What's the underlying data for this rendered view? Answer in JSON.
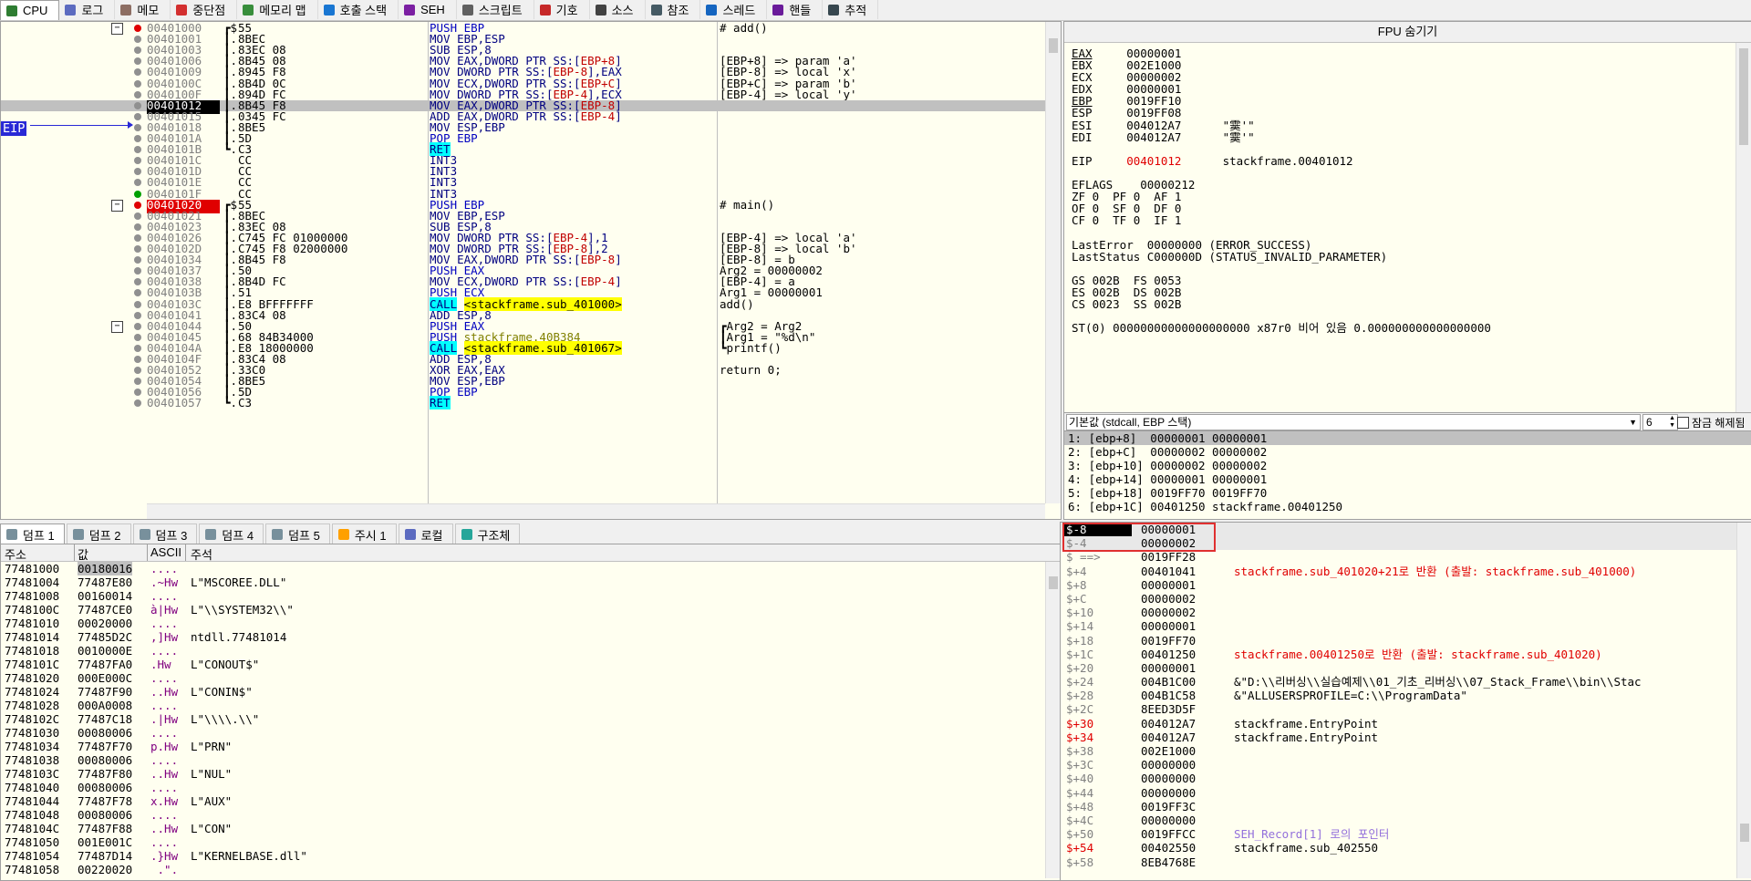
{
  "top_tabs": [
    {
      "label": "CPU",
      "icon": "cpu-icon",
      "active": true
    },
    {
      "label": "로그",
      "icon": "log-icon"
    },
    {
      "label": "메모",
      "icon": "notes-icon"
    },
    {
      "label": "중단점",
      "icon": "breakpoint-icon"
    },
    {
      "label": "메모리 맵",
      "icon": "memory-map-icon"
    },
    {
      "label": "호출 스택",
      "icon": "call-stack-icon"
    },
    {
      "label": "SEH",
      "icon": "seh-icon"
    },
    {
      "label": "스크립트",
      "icon": "script-icon"
    },
    {
      "label": "기호",
      "icon": "symbols-icon"
    },
    {
      "label": "소스",
      "icon": "source-icon"
    },
    {
      "label": "참조",
      "icon": "references-icon"
    },
    {
      "label": "스레드",
      "icon": "threads-icon"
    },
    {
      "label": "핸들",
      "icon": "handles-icon"
    },
    {
      "label": "추적",
      "icon": "trace-icon"
    }
  ],
  "eip_label": "EIP",
  "disasm": [
    {
      "addr": "00401000",
      "brk": true,
      "fold": true,
      "b": "┏$",
      "bytes": "55",
      "asm": "PUSH EBP",
      "cmt": "# add()",
      "kind": "push"
    },
    {
      "addr": "00401001",
      "b": "┃.",
      "bytes": "8BEC",
      "asm": "MOV EBP,ESP",
      "cmt": ""
    },
    {
      "addr": "00401003",
      "b": "┃.",
      "bytes": "83EC 08",
      "asm": "SUB ESP,8",
      "cmt": ""
    },
    {
      "addr": "00401006",
      "b": "┃.",
      "bytes": "8B45 08",
      "asm": "MOV EAX,DWORD PTR SS:[EBP+8]",
      "cmt": "[EBP+8] => param 'a'"
    },
    {
      "addr": "00401009",
      "b": "┃.",
      "bytes": "8945 F8",
      "asm": "MOV DWORD PTR SS:[EBP-8],EAX",
      "cmt": "[EBP-8] => local 'x'"
    },
    {
      "addr": "0040100C",
      "b": "┃.",
      "bytes": "8B4D 0C",
      "asm": "MOV ECX,DWORD PTR SS:[EBP+C]",
      "cmt": "[EBP+C] => param 'b'"
    },
    {
      "addr": "0040100F",
      "b": "┃.",
      "bytes": "894D FC",
      "asm": "MOV DWORD PTR SS:[EBP-4],ECX",
      "cmt": "[EBP-4] => local 'y'"
    },
    {
      "addr": "00401012",
      "eip": true,
      "b": "┃.",
      "bytes": "8B45 F8",
      "asm": "MOV EAX,DWORD PTR SS:[EBP-8]",
      "cmt": ""
    },
    {
      "addr": "00401015",
      "b": "┃.",
      "bytes": "0345 FC",
      "asm": "ADD EAX,DWORD PTR SS:[EBP-4]",
      "cmt": ""
    },
    {
      "addr": "00401018",
      "b": "┃.",
      "bytes": "8BE5",
      "asm": "MOV ESP,EBP",
      "cmt": ""
    },
    {
      "addr": "0040101A",
      "b": "┃.",
      "bytes": "5D",
      "asm": "POP EBP",
      "cmt": "",
      "kind": "push"
    },
    {
      "addr": "0040101B",
      "b": "┗.",
      "bytes": "C3",
      "asm": "RET",
      "cmt": "",
      "kind": "ret"
    },
    {
      "addr": "0040101C",
      "b": "",
      "bytes": "CC",
      "asm": "INT3",
      "cmt": ""
    },
    {
      "addr": "0040101D",
      "b": "",
      "bytes": "CC",
      "asm": "INT3",
      "cmt": ""
    },
    {
      "addr": "0040101E",
      "b": "",
      "bytes": "CC",
      "asm": "INT3",
      "cmt": ""
    },
    {
      "addr": "0040101F",
      "b": "",
      "bytes": "CC",
      "asm": "INT3",
      "cmt": "",
      "green": true
    },
    {
      "addr": "00401020",
      "brk": true,
      "red": true,
      "fold": true,
      "b": "┏$",
      "bytes": "55",
      "asm": "PUSH EBP",
      "cmt": "# main()",
      "kind": "push"
    },
    {
      "addr": "00401021",
      "b": "┃.",
      "bytes": "8BEC",
      "asm": "MOV EBP,ESP",
      "cmt": ""
    },
    {
      "addr": "00401023",
      "b": "┃.",
      "bytes": "83EC 08",
      "asm": "SUB ESP,8",
      "cmt": ""
    },
    {
      "addr": "00401026",
      "b": "┃.",
      "bytes": "C745 FC 01000000",
      "asm": "MOV DWORD PTR SS:[EBP-4],1",
      "cmt": "[EBP-4] => local 'a'"
    },
    {
      "addr": "0040102D",
      "b": "┃.",
      "bytes": "C745 F8 02000000",
      "asm": "MOV DWORD PTR SS:[EBP-8],2",
      "cmt": "[EBP-8] => local 'b'"
    },
    {
      "addr": "00401034",
      "b": "┃.",
      "bytes": "8B45 F8",
      "asm": "MOV EAX,DWORD PTR SS:[EBP-8]",
      "cmt": "[EBP-8] = b"
    },
    {
      "addr": "00401037",
      "b": "┃.",
      "bytes": "50",
      "asm": "PUSH EAX",
      "cmt": "Arg2 = 00000002",
      "kind": "push"
    },
    {
      "addr": "00401038",
      "b": "┃.",
      "bytes": "8B4D FC",
      "asm": "MOV ECX,DWORD PTR SS:[EBP-4]",
      "cmt": "[EBP-4] = a"
    },
    {
      "addr": "0040103B",
      "b": "┃.",
      "bytes": "51",
      "asm": "PUSH ECX",
      "cmt": "Arg1 = 00000001",
      "kind": "push"
    },
    {
      "addr": "0040103C",
      "b": "┃.",
      "bytes": "E8 BFFFFFFF",
      "asm": "CALL <stackframe.sub_401000>",
      "cmt": "add()",
      "kind": "call"
    },
    {
      "addr": "00401041",
      "b": "┃.",
      "bytes": "83C4 08",
      "asm": "ADD ESP,8",
      "cmt": ""
    },
    {
      "addr": "00401044",
      "fold": true,
      "b": "┃.",
      "bytes": "50",
      "asm": "PUSH EAX",
      "cmt": "┏Arg2 = Arg2",
      "kind": "push"
    },
    {
      "addr": "00401045",
      "b": "┃.",
      "bytes": "68 84B34000",
      "asm": "PUSH stackframe.40B384",
      "cmt": "┃Arg1 = \"%d\\n\"",
      "kind": "push"
    },
    {
      "addr": "0040104A",
      "b": "┃.",
      "bytes": "E8 18000000",
      "asm": "CALL <stackframe.sub_401067>",
      "cmt": "┗printf()",
      "kind": "call"
    },
    {
      "addr": "0040104F",
      "b": "┃.",
      "bytes": "83C4 08",
      "asm": "ADD ESP,8",
      "cmt": ""
    },
    {
      "addr": "00401052",
      "b": "┃.",
      "bytes": "33C0",
      "asm": "XOR EAX,EAX",
      "cmt": "return 0;"
    },
    {
      "addr": "00401054",
      "b": "┃.",
      "bytes": "8BE5",
      "asm": "MOV ESP,EBP",
      "cmt": ""
    },
    {
      "addr": "00401056",
      "b": "┃.",
      "bytes": "5D",
      "asm": "POP EBP",
      "cmt": "",
      "kind": "push"
    },
    {
      "addr": "00401057",
      "b": "┗.",
      "bytes": "C3",
      "asm": "RET",
      "cmt": "",
      "kind": "ret"
    }
  ],
  "fpu": {
    "title": "FPU 숨기기",
    "lines": [
      "EAX     00000001",
      "EBX     002E1000",
      "ECX     00000002",
      "EDX     00000001",
      "EBP     0019FF10",
      "ESP     0019FF08",
      "ESI     004012A7      \"霙'\"",
      "EDI     004012A7      \"霙'\"",
      "",
      "EIP     00401012      stackframe.00401012",
      "",
      "EFLAGS    00000212",
      "ZF 0  PF 0  AF 1",
      "OF 0  SF 0  DF 0",
      "CF 0  TF 0  IF 1",
      "",
      "LastError  00000000 (ERROR_SUCCESS)",
      "LastStatus C000000D (STATUS_INVALID_PARAMETER)",
      "",
      "GS 002B  FS 0053",
      "ES 002B  DS 002B",
      "CS 0023  SS 002B",
      "",
      "ST(0) 00000000000000000000 x87r0 비어 있음 0.000000000000000000"
    ]
  },
  "call_conv": {
    "selected": "기본값 (stdcall, EBP 스택)",
    "count": "6",
    "lock_label": "잠금 해제됨"
  },
  "args": [
    "1: [ebp+8]  00000001 00000001",
    "2: [ebp+C]  00000002 00000002",
    "3: [ebp+10] 00000002 00000002",
    "4: [ebp+14] 00000001 00000001",
    "5: [ebp+18] 0019FF70 0019FF70",
    "6: [ebp+1C] 00401250 stackframe.00401250"
  ],
  "dump_tabs": [
    {
      "label": "덤프 1",
      "active": true
    },
    {
      "label": "덤프 2"
    },
    {
      "label": "덤프 3"
    },
    {
      "label": "덤프 4"
    },
    {
      "label": "덤프 5"
    },
    {
      "label": "주시 1"
    },
    {
      "label": "로컬"
    },
    {
      "label": "구조체"
    }
  ],
  "dump_header": {
    "addr": "주소",
    "val": "값",
    "ascii": "ASCII",
    "cmt": "주석"
  },
  "dump": [
    {
      "a": "77481000",
      "v": "00180016",
      "s": "....",
      "c": ""
    },
    {
      "a": "77481004",
      "v": "77487E80",
      "s": ".~Hw",
      "c": "L\"MSCOREE.DLL\""
    },
    {
      "a": "77481008",
      "v": "00160014",
      "s": "....",
      "c": ""
    },
    {
      "a": "7748100C",
      "v": "77487CE0",
      "s": "à|Hw",
      "c": "L\"\\\\SYSTEM32\\\\\""
    },
    {
      "a": "77481010",
      "v": "00020000",
      "s": "....",
      "c": ""
    },
    {
      "a": "77481014",
      "v": "77485D2C",
      "s": ",]Hw",
      "c": "ntdll.77481014"
    },
    {
      "a": "77481018",
      "v": "0010000E",
      "s": "....",
      "c": ""
    },
    {
      "a": "7748101C",
      "v": "77487FA0",
      "s": ".Hw",
      "c": "L\"CONOUT$\""
    },
    {
      "a": "77481020",
      "v": "000E000C",
      "s": "....",
      "c": ""
    },
    {
      "a": "77481024",
      "v": "77487F90",
      "s": "..Hw",
      "c": "L\"CONIN$\""
    },
    {
      "a": "77481028",
      "v": "000A0008",
      "s": "....",
      "c": ""
    },
    {
      "a": "7748102C",
      "v": "77487C18",
      "s": ".|Hw",
      "c": "L\"\\\\\\\\.\\\\\""
    },
    {
      "a": "77481030",
      "v": "00080006",
      "s": "....",
      "c": ""
    },
    {
      "a": "77481034",
      "v": "77487F70",
      "s": "p.Hw",
      "c": "L\"PRN\""
    },
    {
      "a": "77481038",
      "v": "00080006",
      "s": "....",
      "c": ""
    },
    {
      "a": "7748103C",
      "v": "77487F80",
      "s": "..Hw",
      "c": "L\"NUL\""
    },
    {
      "a": "77481040",
      "v": "00080006",
      "s": "....",
      "c": ""
    },
    {
      "a": "77481044",
      "v": "77487F78",
      "s": "x.Hw",
      "c": "L\"AUX\""
    },
    {
      "a": "77481048",
      "v": "00080006",
      "s": "....",
      "c": ""
    },
    {
      "a": "7748104C",
      "v": "77487F88",
      "s": "..Hw",
      "c": "L\"CON\""
    },
    {
      "a": "77481050",
      "v": "001E001C",
      "s": "....",
      "c": ""
    },
    {
      "a": "77481054",
      "v": "77487D14",
      "s": ".}Hw",
      "c": "L\"KERNELBASE.dll\""
    },
    {
      "a": "77481058",
      "v": "00220020",
      "s": " .\".",
      "c": ""
    }
  ],
  "stack": [
    {
      "o": "$-8",
      "v": "00000001",
      "c": "",
      "sel": true
    },
    {
      "o": "$-4",
      "v": "00000002",
      "c": ""
    },
    {
      "o": "$ ==>",
      "v": "0019FF28",
      "c": ""
    },
    {
      "o": "$+4",
      "v": "00401041",
      "c": "stackframe.sub_401020+21로 반환 (출발: stackframe.sub_401000)",
      "red": true
    },
    {
      "o": "$+8",
      "v": "00000001",
      "c": ""
    },
    {
      "o": "$+C",
      "v": "00000002",
      "c": ""
    },
    {
      "o": "$+10",
      "v": "00000002",
      "c": ""
    },
    {
      "o": "$+14",
      "v": "00000001",
      "c": ""
    },
    {
      "o": "$+18",
      "v": "0019FF70",
      "c": ""
    },
    {
      "o": "$+1C",
      "v": "00401250",
      "c": "stackframe.00401250로 반환 (출발: stackframe.sub_401020)",
      "red": true
    },
    {
      "o": "$+20",
      "v": "00000001",
      "c": ""
    },
    {
      "o": "$+24",
      "v": "004B1C00",
      "c": "&\"D:\\\\리버싱\\\\실습예제\\\\01_기초_리버싱\\\\07_Stack_Frame\\\\bin\\\\Stac"
    },
    {
      "o": "$+28",
      "v": "004B1C58",
      "c": "&\"ALLUSERSPROFILE=C:\\\\ProgramData\""
    },
    {
      "o": "$+2C",
      "v": "8EED3D5F",
      "c": ""
    },
    {
      "o": "$+30",
      "v": "004012A7",
      "c": "stackframe.EntryPoint",
      "ored": true
    },
    {
      "o": "$+34",
      "v": "004012A7",
      "c": "stackframe.EntryPoint",
      "ored": true
    },
    {
      "o": "$+38",
      "v": "002E1000",
      "c": ""
    },
    {
      "o": "$+3C",
      "v": "00000000",
      "c": ""
    },
    {
      "o": "$+40",
      "v": "00000000",
      "c": ""
    },
    {
      "o": "$+44",
      "v": "00000000",
      "c": ""
    },
    {
      "o": "$+48",
      "v": "0019FF3C",
      "c": ""
    },
    {
      "o": "$+4C",
      "v": "00000000",
      "c": ""
    },
    {
      "o": "$+50",
      "v": "0019FFCC",
      "c": "SEH_Record[1] 로의 포인터",
      "seh": true
    },
    {
      "o": "$+54",
      "v": "00402550",
      "c": "stackframe.sub_402550",
      "ored": true
    },
    {
      "o": "$+58",
      "v": "8EB4768E",
      "c": ""
    }
  ]
}
